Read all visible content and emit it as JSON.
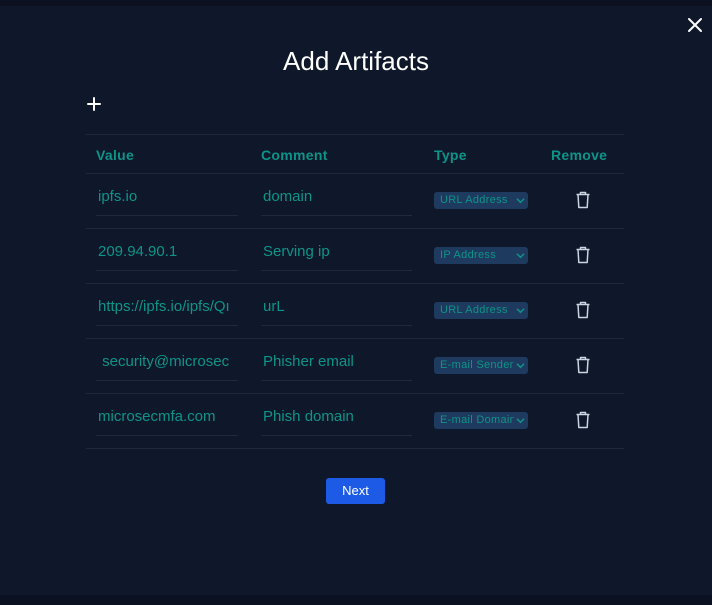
{
  "modal": {
    "title": "Add Artifacts",
    "next_label": "Next"
  },
  "table": {
    "headers": {
      "value": "Value",
      "comment": "Comment",
      "type": "Type",
      "remove": "Remove"
    },
    "rows": [
      {
        "value": "ipfs.io",
        "comment": "domain",
        "type": "URL Address"
      },
      {
        "value": "209.94.90.1",
        "comment": "Serving ip",
        "type": "IP Address"
      },
      {
        "value": "https://ipfs.io/ipfs/Qı",
        "comment": "urL",
        "type": "URL Address"
      },
      {
        "value": " security@microsec",
        "comment": "Phisher email",
        "type": "E-mail Sender"
      },
      {
        "value": "microsecmfa.com",
        "comment": "Phish domain",
        "type": "E-mail Domain"
      }
    ]
  },
  "icons": {
    "close": "close-icon",
    "add": "plus-icon",
    "remove": "trash-icon",
    "dropdown": "chevron-down-icon"
  },
  "colors": {
    "background": "#0f172a",
    "accent_teal": "#0d9488",
    "primary_button": "#1d5be6",
    "select_bg": "#1e3a5f"
  }
}
